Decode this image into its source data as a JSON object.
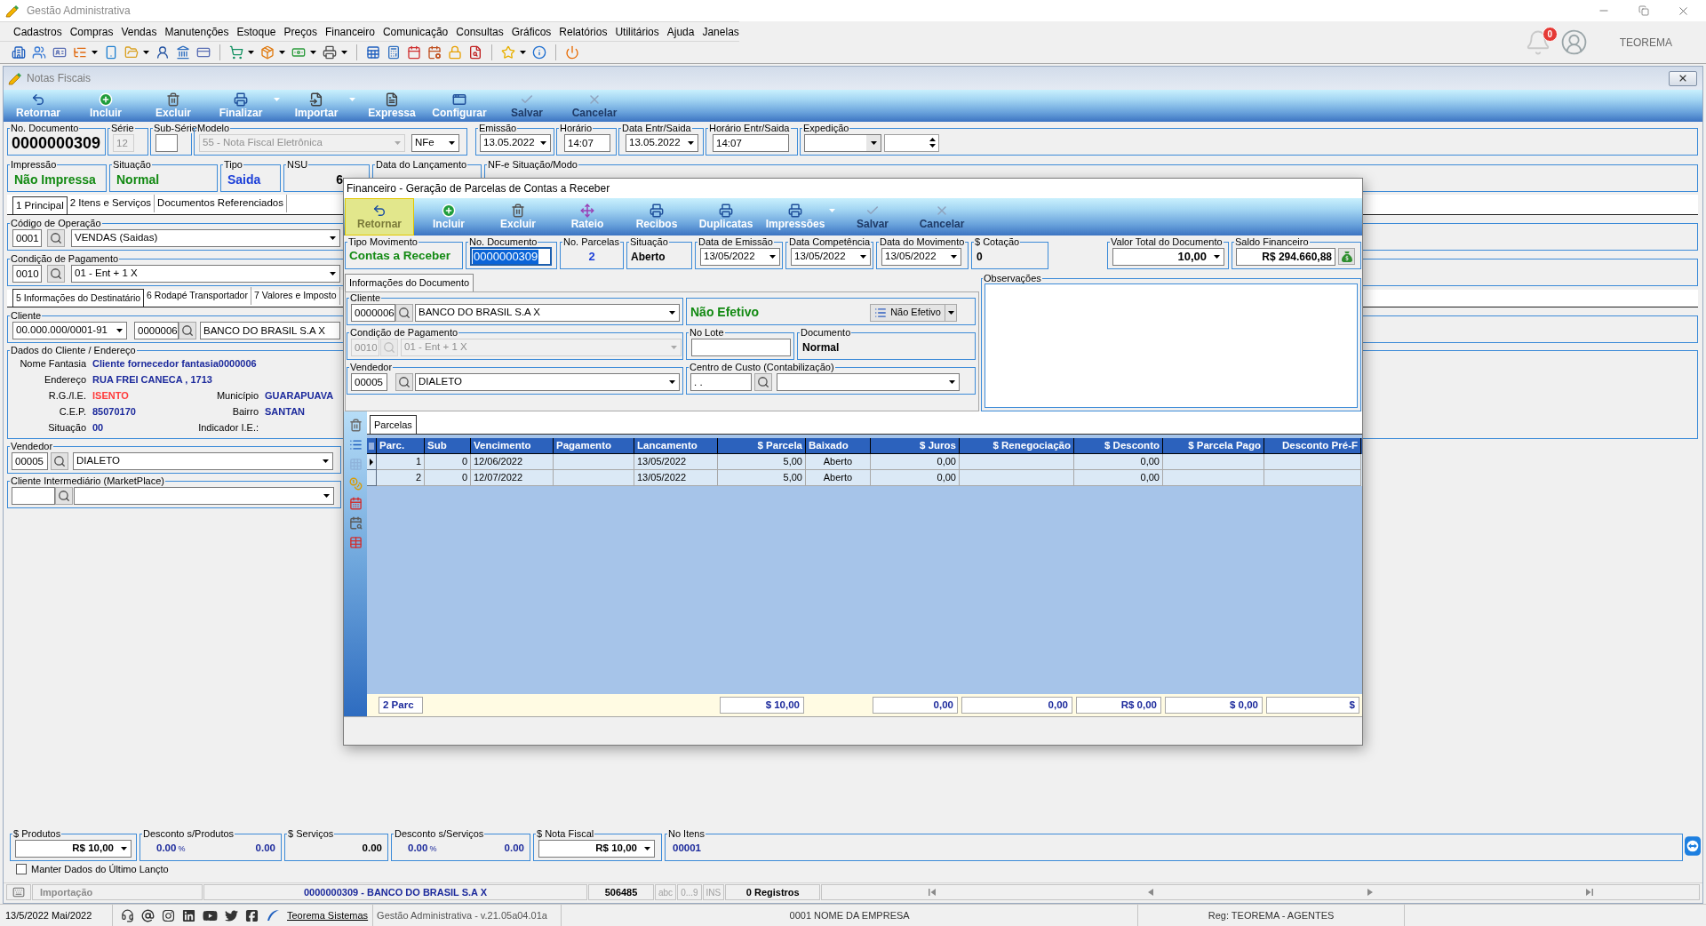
{
  "window": {
    "title": "Gestão Administrativa"
  },
  "menu": [
    "Cadastros",
    "Compras",
    "Vendas",
    "Manutenções",
    "Estoque",
    "Preços",
    "Financeiro",
    "Comunicação",
    "Consultas",
    "Gráficos",
    "Relatórios",
    "Utilitários",
    "Ajuda",
    "Janelas"
  ],
  "notifications": {
    "count": "0"
  },
  "user": {
    "name": "TEOREMA"
  },
  "nf_window": {
    "title": "Notas Fiscais",
    "toolbar": [
      {
        "label": "Retornar",
        "disabled": false,
        "dropdown": false
      },
      {
        "label": "Incluir",
        "disabled": false,
        "dropdown": false
      },
      {
        "label": "Excluir",
        "disabled": false,
        "dropdown": false
      },
      {
        "label": "Finalizar",
        "disabled": false,
        "dropdown": true
      },
      {
        "label": "Importar",
        "disabled": false,
        "dropdown": true
      },
      {
        "label": "Expressa",
        "disabled": false,
        "dropdown": false
      },
      {
        "label": "Configurar",
        "disabled": false,
        "dropdown": false
      },
      {
        "label": "Salvar",
        "disabled": true,
        "dropdown": false
      },
      {
        "label": "Cancelar",
        "disabled": true,
        "dropdown": false
      }
    ],
    "numero": {
      "label": "No. Documento",
      "value": "0000000309"
    },
    "serie": {
      "label": "Série",
      "value": "12",
      "disabled": true
    },
    "subserie": {
      "label": "Sub-Série"
    },
    "modelo": {
      "label": "Modelo",
      "value": "55 - Nota Fiscal Eletrônica",
      "disabled": true,
      "tipo": "NFe"
    },
    "emissao": {
      "label": "Emissão",
      "value": "13.05.2022"
    },
    "horario": {
      "label": "Horário",
      "value": "14:07"
    },
    "data_entr_saida": {
      "label": "Data Entr/Saida",
      "value": "13.05.2022"
    },
    "horario_entr_saida": {
      "label": "Horário Entr/Saida",
      "value": "14:07"
    },
    "expedicao": {
      "label": "Expedição"
    },
    "status": [
      {
        "label": "Impressão",
        "value": "Não Impressa",
        "color": "#138a13"
      },
      {
        "label": "Situação",
        "value": "Normal",
        "color": "#138a13"
      },
      {
        "label": "Tipo",
        "value": "Saida",
        "color": "#1c3fd8"
      },
      {
        "label": "NSU",
        "value": "6"
      }
    ],
    "data_lancamento": {
      "label": "Data do Lançamento"
    },
    "nfe_situacao": {
      "label": "NF-e Situação/Modo"
    },
    "tabs": [
      {
        "label": "1 Principal",
        "selected": true
      },
      {
        "label": "2 Itens e Serviços",
        "selected": false
      },
      {
        "label": "Documentos Referenciados",
        "selected": false
      }
    ],
    "operacao": {
      "label": "Código de Operação",
      "code": "0001",
      "value": "VENDAS (Saidas)"
    },
    "condicao": {
      "label": "Condição de Pagamento",
      "code": "0010",
      "value": "01 - Ent + 1 X"
    },
    "sub_tabs": [
      {
        "label": "5 Informações do Destinatário",
        "selected": true
      },
      {
        "label": "6 Rodapé Transportador",
        "selected": false
      },
      {
        "label": "7 Valores e Imposto",
        "selected": false
      }
    ],
    "cliente": {
      "label": "Cliente",
      "cnpj": "00.000.000/0001-91",
      "code": "0000006",
      "name": "BANCO DO BRASIL S.A X"
    },
    "dados_cliente": {
      "label": "Dados do Cliente / Endereço",
      "rows": [
        [
          {
            "label": "Nome Fantasia",
            "value": "Cliente fornecedor fantasia0000006",
            "color": "#1c2a9c"
          }
        ],
        [
          {
            "label": "Endereço",
            "value": "RUA FREI CANECA , 1713",
            "color": "#1c2a9c"
          }
        ],
        [
          {
            "label": "R.G./I.E.",
            "value": "ISENTO",
            "color": "#ff3b3b"
          },
          {
            "label": "Município",
            "value": "GUARAPUAVA",
            "color": "#1c2a9c"
          }
        ],
        [
          {
            "label": "C.E.P.",
            "value": "85070170",
            "color": "#1c2a9c"
          },
          {
            "label": "Bairro",
            "value": "SANTAN",
            "color": "#1c2a9c"
          }
        ],
        [
          {
            "label": "Situação",
            "value": "00",
            "color": "#1c2a9c"
          },
          {
            "label": "Indicador I.E.:"
          }
        ]
      ]
    },
    "vendedor": {
      "label": "Vendedor",
      "code": "00005",
      "value": "DIALETO"
    },
    "intermediario": {
      "label": "Cliente Intermediário (MarketPlace)"
    },
    "totais": [
      {
        "kind": "combo",
        "label": "$ Produtos",
        "value": "R$ 10,00"
      },
      {
        "kind": "discount",
        "label": "Desconto s/Produtos",
        "percent": "0.00",
        "unit": "%",
        "value": "0.00"
      },
      {
        "kind": "amount",
        "label": "$ Serviços",
        "value": "0.00"
      },
      {
        "kind": "discount",
        "label": "Desconto s/Serviços",
        "percent": "0.00",
        "unit": "%",
        "value": "0.00"
      },
      {
        "kind": "combo",
        "label": "$ Nota Fiscal",
        "value": "R$ 10,00"
      },
      {
        "kind": "count",
        "label": "No Itens",
        "value": "00001"
      }
    ],
    "manter_dados": {
      "label": "Manter Dados do Último Lançto",
      "checked": false
    },
    "status_bar": {
      "mode": "Importação",
      "record": "0000000309 - BANCO DO BRASIL S.A X",
      "code": "506485",
      "indicators": [
        {
          "label": "abc",
          "on": false
        },
        {
          "label": "0...9",
          "on": false
        },
        {
          "label": "INS",
          "on": false
        }
      ],
      "count": "0 Registros"
    }
  },
  "dialog": {
    "title": "Financeiro - Geração de Parcelas de Contas a Receber",
    "toolbar": [
      {
        "label": "Retornar",
        "selected": true,
        "disabled": false,
        "dropdown": false
      },
      {
        "label": "Incluir",
        "selected": false,
        "disabled": false,
        "dropdown": false
      },
      {
        "label": "Excluir",
        "selected": false,
        "disabled": false,
        "dropdown": false
      },
      {
        "label": "Rateio",
        "selected": false,
        "disabled": false,
        "dropdown": false
      },
      {
        "label": "Recibos",
        "selected": false,
        "disabled": false,
        "dropdown": false
      },
      {
        "label": "Duplicatas",
        "selected": false,
        "disabled": false,
        "dropdown": false
      },
      {
        "label": "Impressões",
        "selected": false,
        "disabled": false,
        "dropdown": true
      },
      {
        "label": "Salvar",
        "selected": false,
        "disabled": true,
        "dropdown": false
      },
      {
        "label": "Cancelar",
        "selected": false,
        "disabled": true,
        "dropdown": false
      }
    ],
    "tipo_movimento": {
      "label": "Tipo Movimento",
      "value": "Contas a Receber"
    },
    "documento": {
      "label": "No. Documento",
      "value": "0000000309",
      "text_selected": true
    },
    "parcelas_count": {
      "label": "No. Parcelas",
      "value": "2"
    },
    "situacao": {
      "label": "Situação",
      "value": "Aberto"
    },
    "datas": [
      {
        "label": "Data de Emissão",
        "value": "13/05/2022"
      },
      {
        "label": "Data Competência",
        "value": "13/05/2022"
      },
      {
        "label": "Data do Movimento",
        "value": "13/05/2022"
      }
    ],
    "cotacao": {
      "label": "$ Cotação",
      "value": "0"
    },
    "valor_total": {
      "label": "Valor Total do Documento",
      "value": "10,00"
    },
    "saldo": {
      "label": "Saldo Financeiro",
      "value": "R$ 294.660,88"
    },
    "info_tab": {
      "label": "Informações do Documento",
      "selected": true
    },
    "cliente": {
      "label": "Cliente",
      "code": "0000006",
      "value": "BANCO DO BRASIL S.A X"
    },
    "efetivo": {
      "status": "Não Efetivo",
      "button": "Não Efetivo"
    },
    "condicao": {
      "label": "Condição de Pagamento",
      "code": "0010",
      "value": "01 - Ent + 1 X",
      "disabled": true
    },
    "lote": {
      "label": "No Lote"
    },
    "tipo_documento": {
      "label": "Documento",
      "value": "Normal"
    },
    "vendedor": {
      "label": "Vendedor",
      "code": "00005",
      "value": "DIALETO"
    },
    "centro_custo": {
      "label": "Centro de Custo (Contabilização)",
      "code": " .  ."
    },
    "observacoes": {
      "label": "Observações"
    },
    "grid_tab": {
      "label": "Parcelas",
      "selected": true
    },
    "columns": [
      "Parc.",
      "Sub",
      "Vencimento",
      "Pagamento",
      "Lancamento",
      "$ Parcela",
      "Baixado",
      "$ Juros",
      "$ Renegociação",
      "$ Desconto",
      "$ Parcela Pago",
      "Desconto Pré-F"
    ],
    "rows": [
      {
        "selected": true,
        "parc": "1",
        "sub": "0",
        "vencimento": "12/06/2022",
        "lancamento": "13/05/2022",
        "parcela": "5,00",
        "baixado": "Aberto",
        "juros": "0,00",
        "desconto": "0,00"
      },
      {
        "selected": false,
        "parc": "2",
        "sub": "0",
        "vencimento": "12/07/2022",
        "lancamento": "13/05/2022",
        "parcela": "5,00",
        "baixado": "Aberto",
        "juros": "0,00",
        "desconto": "0,00"
      }
    ],
    "totals": {
      "parc": "2 Parc",
      "parcela": "$ 10,00",
      "juros": "0,00",
      "renegociacao": "0,00",
      "desconto": "R$ 0,00",
      "parcela_pago": "$ 0,00",
      "desconto_pre": "$"
    }
  },
  "app_status": {
    "date": "13/5/2022 Mai/2022",
    "link": "Teorema Sistemas",
    "version": "Gestão Administrativa - v.21.05a04.01a",
    "company": "0001 NOME DA EMPRESA",
    "registration": "Reg: TEOREMA - AGENTES"
  }
}
